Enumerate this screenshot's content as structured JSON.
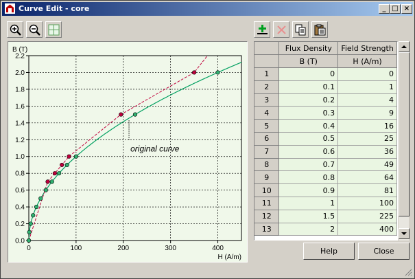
{
  "window": {
    "title": "Curve Edit - core"
  },
  "toolbar": {
    "left": [
      "zoom-in-icon",
      "zoom-out-icon",
      "zoom-fit-icon"
    ],
    "right": [
      "add-point-icon",
      "delete-point-icon",
      "copy-icon",
      "paste-icon"
    ]
  },
  "grid": {
    "headers": [
      "Flux Density",
      "Field Strength"
    ],
    "units": [
      "B (T)",
      "H (A/m)"
    ],
    "rows": [
      [
        "1",
        "0",
        "0"
      ],
      [
        "2",
        "0.1",
        "1"
      ],
      [
        "3",
        "0.2",
        "4"
      ],
      [
        "4",
        "0.3",
        "9"
      ],
      [
        "5",
        "0.4",
        "16"
      ],
      [
        "6",
        "0.5",
        "25"
      ],
      [
        "7",
        "0.6",
        "36"
      ],
      [
        "8",
        "0.7",
        "49"
      ],
      [
        "9",
        "0.8",
        "64"
      ],
      [
        "10",
        "0.9",
        "81"
      ],
      [
        "11",
        "1",
        "100"
      ],
      [
        "12",
        "1.5",
        "225"
      ],
      [
        "13",
        "2",
        "400"
      ]
    ]
  },
  "buttons": {
    "help": "Help",
    "close": "Close"
  },
  "colors": {
    "curve": "#00a060",
    "original_curve": "#c0003c",
    "plot_bg": "#f0f8ea"
  },
  "chart_data": {
    "type": "scatter",
    "xlabel": "H (A/m)",
    "ylabel": "B (T)",
    "xlim": [
      0,
      450
    ],
    "ylim": [
      0,
      2.2
    ],
    "xticks": [
      0,
      100,
      200,
      300,
      400
    ],
    "yticks": [
      0,
      0.2,
      0.4,
      0.6,
      0.8,
      1.0,
      1.2,
      1.4,
      1.6,
      1.8,
      2.0,
      2.2
    ],
    "grid": true,
    "annotation": "original curve",
    "series": [
      {
        "style": "solid",
        "points": [
          [
            0,
            0
          ],
          [
            1,
            0.1
          ],
          [
            4,
            0.2
          ],
          [
            9,
            0.3
          ],
          [
            16,
            0.4
          ],
          [
            25,
            0.5
          ],
          [
            36,
            0.6
          ],
          [
            49,
            0.7
          ],
          [
            64,
            0.8
          ],
          [
            81,
            0.9
          ],
          [
            100,
            1.0
          ],
          [
            225,
            1.5
          ],
          [
            400,
            2.0
          ]
        ]
      },
      {
        "style": "dashed",
        "points": [
          [
            0,
            0
          ],
          [
            40,
            0.7
          ],
          [
            55,
            0.8
          ],
          [
            70,
            0.9
          ],
          [
            85,
            1.0
          ],
          [
            195,
            1.5
          ],
          [
            350,
            2.0
          ]
        ]
      }
    ]
  }
}
